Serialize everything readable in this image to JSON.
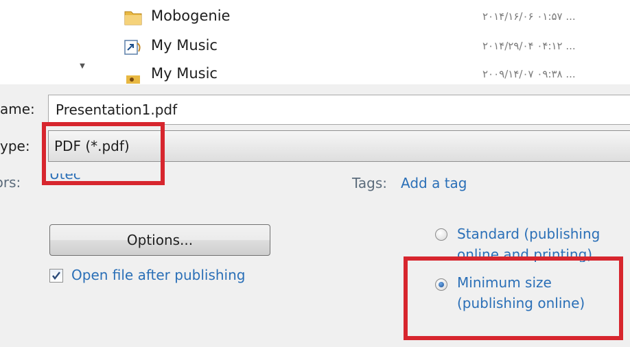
{
  "files": [
    {
      "name": "Mobogenie",
      "date": "۲۰۱۴/۱۶/۰۶ ۰۱:۵۷ ...",
      "icon": "folder-icon"
    },
    {
      "name": "My Music",
      "date": "۲۰۱۴/۲۹/۰۴ ۰۴:۱۲ ...",
      "icon": "shortcut-icon"
    },
    {
      "name": "My Music",
      "date": "۲۰۰۹/۱۴/۰۷ ۰۹:۳۸ ...",
      "icon": "music-folder-icon"
    }
  ],
  "file_name": {
    "label": "ame:",
    "value": "Presentation1.pdf"
  },
  "save_type": {
    "label": "ype:",
    "value": "PDF (*.pdf)"
  },
  "authors": {
    "label": "hors:",
    "value": "Utec"
  },
  "tags": {
    "label": "Tags:",
    "value": "Add a tag"
  },
  "options_button": "Options...",
  "open_after": {
    "label": "Open file after publishing",
    "checked": true
  },
  "optimize": {
    "standard_label_1": "Standard (publishing",
    "standard_label_2": "online and printing)",
    "minimum_label_1": "Minimum size",
    "minimum_label_2": "(publishing online)",
    "selected": "minimum"
  },
  "colors": {
    "highlight": "#d7262e",
    "link": "#2a6fb7"
  }
}
